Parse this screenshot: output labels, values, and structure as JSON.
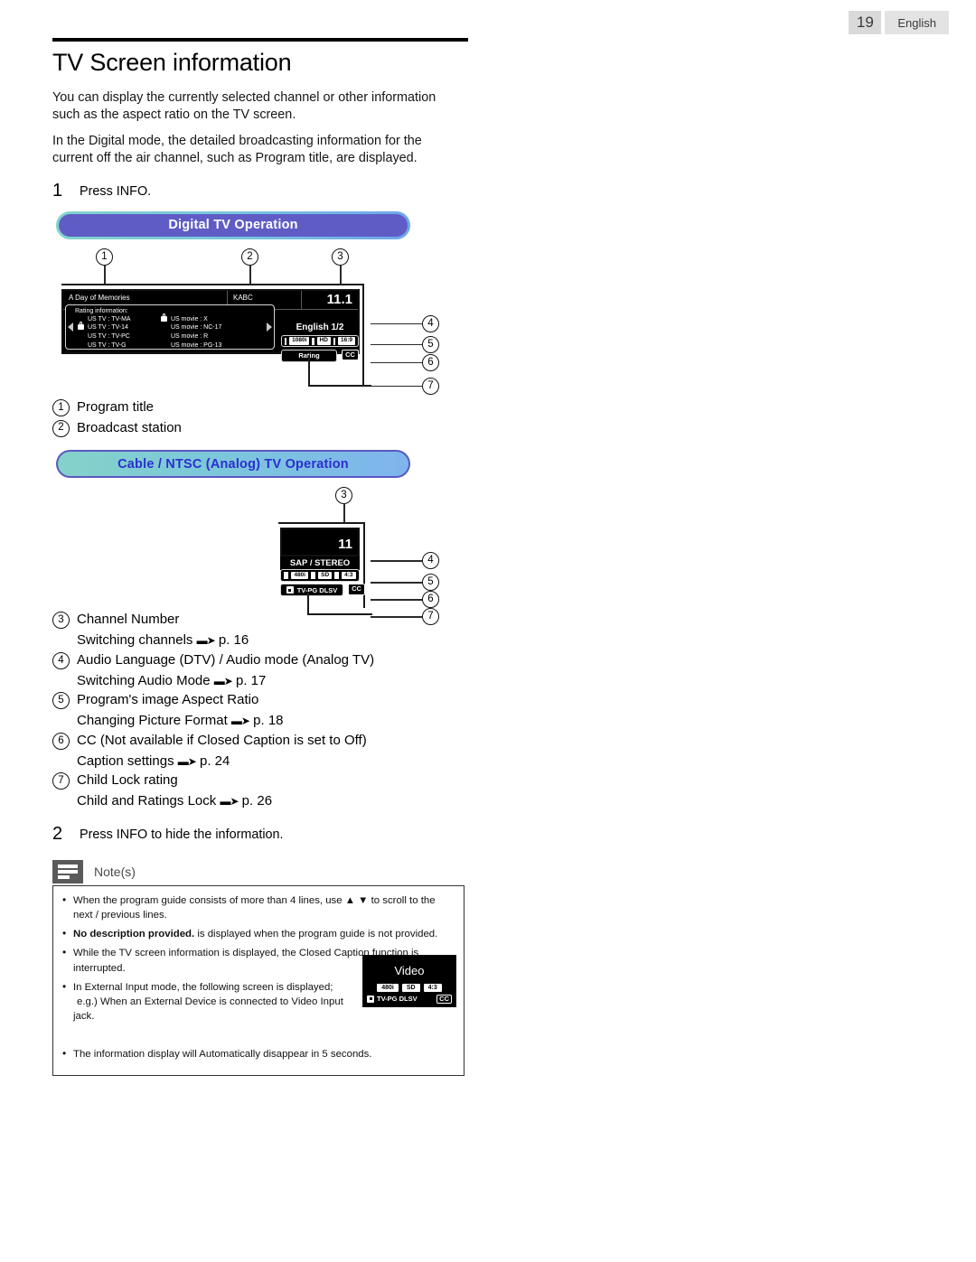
{
  "header": {
    "page_number": "19",
    "language": "English"
  },
  "doc": {
    "title": "TV Screen information",
    "intro_1": "You can display the currently selected channel or other information such as the aspect ratio on the TV screen.",
    "intro_2": "In the Digital mode, the detailed broadcasting information for the current off the air channel, such as Program title, are displayed.",
    "step1_num": "1",
    "step1_text": "Press INFO.",
    "step2_num": "2",
    "step2_text": "Press INFO to hide the information."
  },
  "banners": {
    "digital": "Digital TV Operation",
    "analog": "Cable / NTSC (Analog) TV Operation"
  },
  "digital_screen": {
    "callouts": [
      "1",
      "2",
      "3",
      "4",
      "5",
      "6",
      "7"
    ],
    "program_title": "A Day of Memories",
    "broadcast_station": "KABC",
    "channel_number": "11.1",
    "rating_heading": "Rating information:",
    "rating_left": [
      {
        "lock": false,
        "text": "US TV : TV-MA"
      },
      {
        "lock": true,
        "text": "US TV : TV-14"
      },
      {
        "lock": false,
        "text": "US TV : TV-PC"
      },
      {
        "lock": false,
        "text": "US TV : TV-G"
      }
    ],
    "rating_right": [
      {
        "lock": true,
        "text": "US movie : X"
      },
      {
        "lock": false,
        "text": "US movie : NC-17"
      },
      {
        "lock": false,
        "text": "US movie : R"
      },
      {
        "lock": false,
        "text": "US movie : PG-13"
      }
    ],
    "audio_language": "English 1/2",
    "format_badges": [
      "1080i",
      "HD",
      "16:9"
    ],
    "rating_tag": "Rating",
    "cc_tag": "CC"
  },
  "analog_screen": {
    "callouts": [
      "3",
      "4",
      "5",
      "6",
      "7"
    ],
    "channel_number": "11",
    "audio_mode": "SAP / STEREO",
    "format_badges": [
      "480i",
      "SD",
      "4:3"
    ],
    "rating_tag": "TV-PG DLSV",
    "cc_tag": "CC"
  },
  "legend_top": [
    {
      "num": "1",
      "label": "Program title"
    },
    {
      "num": "2",
      "label": "Broadcast station"
    }
  ],
  "legend_main": [
    {
      "num": "3",
      "label": "Channel Number",
      "ref": "Switching channels",
      "ref_page": "p.  16"
    },
    {
      "num": "4",
      "label": "Audio Language (DTV) / Audio mode (Analog TV)",
      "ref": "Switching Audio Mode",
      "ref_page": "p.  17"
    },
    {
      "num": "5",
      "label": "Program's image Aspect Ratio",
      "ref": "Changing Picture Format",
      "ref_page": "p.  18"
    },
    {
      "num": "6",
      "label": "CC (Not available if Closed Caption is set to Off)",
      "ref": "Caption settings",
      "ref_page": "p.  24"
    },
    {
      "num": "7",
      "label": "Child Lock rating",
      "ref": "Child and Ratings Lock",
      "ref_page": "p.  26"
    }
  ],
  "notes": {
    "title": "Note(s)",
    "items": [
      {
        "text": "When the program guide consists of more than 4 lines, use ▲ ▼ to scroll to the next / previous lines."
      },
      {
        "bold": "No description provided.",
        "text": " is displayed when the program guide is not provided."
      },
      {
        "text": "While the TV screen information is displayed, the Closed Caption function is interrupted."
      },
      {
        "text": "In External Input mode, the following screen is displayed;",
        "text2": "e.g.) When an External Device is connected to Video Input jack."
      },
      {
        "text": "The information display will Automatically disappear in 5 seconds."
      }
    ]
  },
  "video_mock": {
    "label": "Video",
    "badges": [
      "480i",
      "SD",
      "4:3"
    ],
    "rating_tag": "TV-PG DLSV",
    "cc_tag": "CC"
  }
}
